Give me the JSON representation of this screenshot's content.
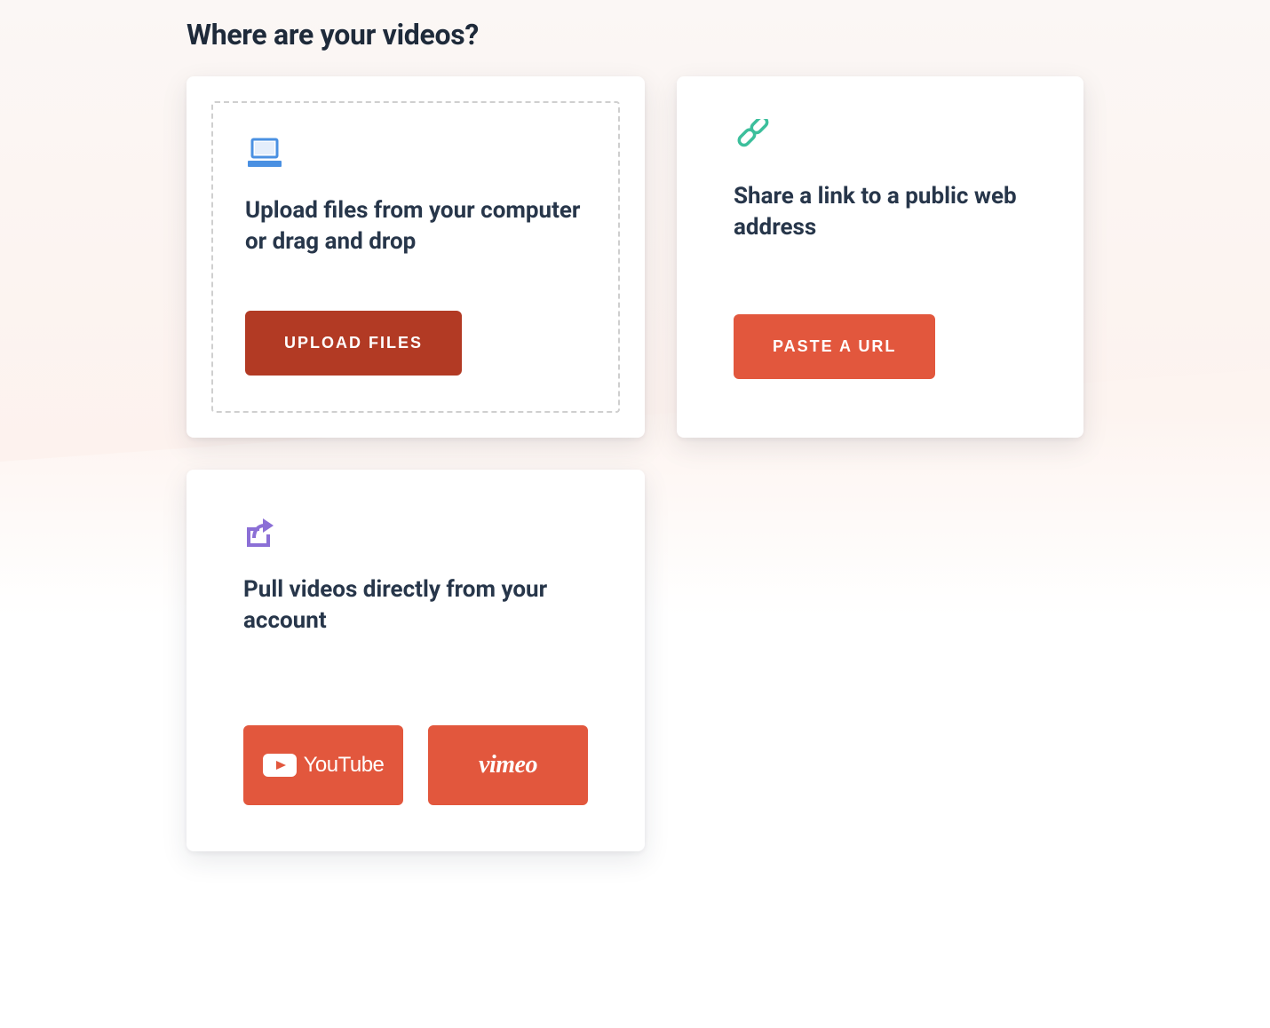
{
  "heading": "Where are your videos?",
  "cards": {
    "upload": {
      "title": "Upload files from your computer or drag and drop",
      "button": "UPLOAD FILES",
      "icon": "laptop-icon"
    },
    "url": {
      "title": "Share a link to a public web address",
      "button": "PASTE A URL",
      "icon": "link-icon"
    },
    "account": {
      "title": "Pull videos directly from your account",
      "icon": "share-icon",
      "providers": {
        "youtube": "YouTube",
        "vimeo": "vimeo"
      }
    }
  },
  "colors": {
    "button_primary": "#e2573d",
    "button_dark": "#b23a24",
    "icon_blue": "#4a90e2",
    "icon_green": "#3cbf9c",
    "icon_purple": "#8b6fd6",
    "text_heading": "#27364a"
  }
}
